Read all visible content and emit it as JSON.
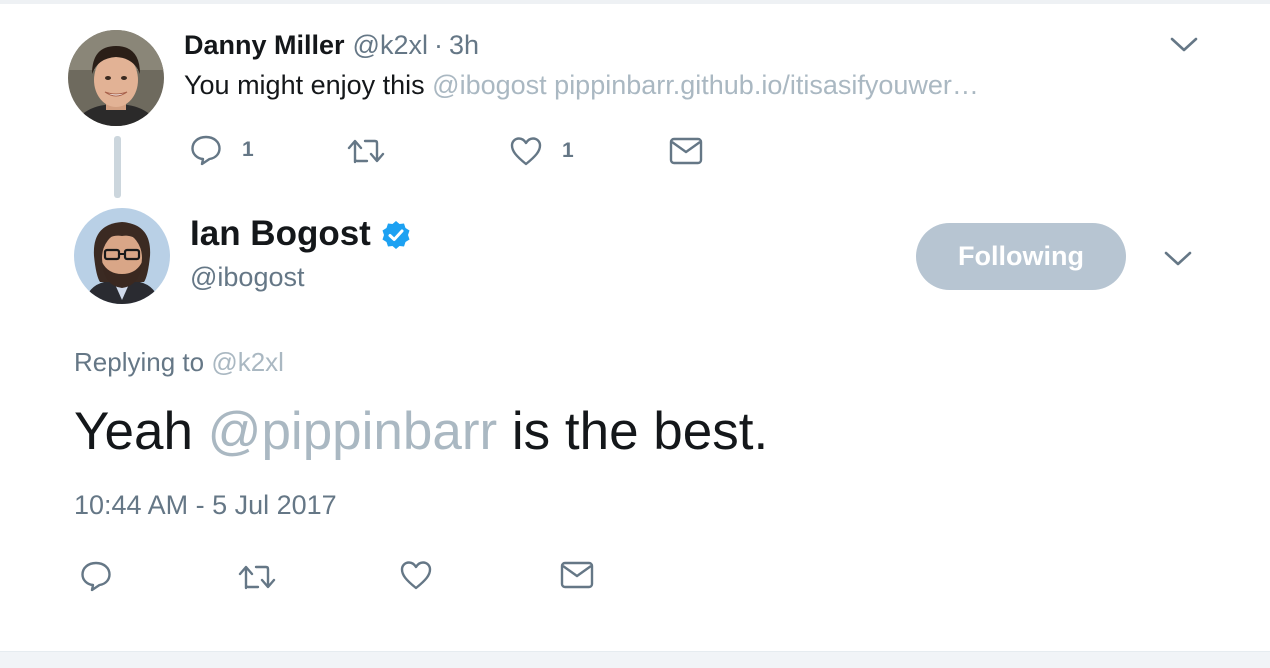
{
  "parent_tweet": {
    "author_name": "Danny Miller",
    "author_handle": "@k2xl",
    "separator": "·",
    "time_ago": "3h",
    "text": "You might enjoy this",
    "mention": "@ibogost",
    "link": "pippinbarr.github.io/itisasifyouwer…",
    "reply_count": "1",
    "like_count": "1",
    "icons": [
      "reply-icon",
      "retweet-icon",
      "like-icon",
      "message-icon",
      "chevron-down-icon"
    ]
  },
  "main_tweet": {
    "author_name": "Ian Bogost",
    "author_handle": "@ibogost",
    "verified": true,
    "follow_button_label": "Following",
    "replying_prefix": "Replying to",
    "replying_handle": "@k2xl",
    "text_before": "Yeah",
    "text_mention": "@pippinbarr",
    "text_after": "is the best.",
    "timestamp": "10:44 AM - 5 Jul 2017",
    "icons": [
      "reply-icon",
      "retweet-icon",
      "like-icon",
      "message-icon",
      "chevron-down-icon"
    ]
  },
  "colors": {
    "text_primary": "#14171a",
    "text_secondary": "#657786",
    "link_muted": "#aab8c2",
    "following_button_bg": "#b7c5d2",
    "verified_blue": "#1da1f2",
    "thread_line": "#ccd6dd"
  }
}
